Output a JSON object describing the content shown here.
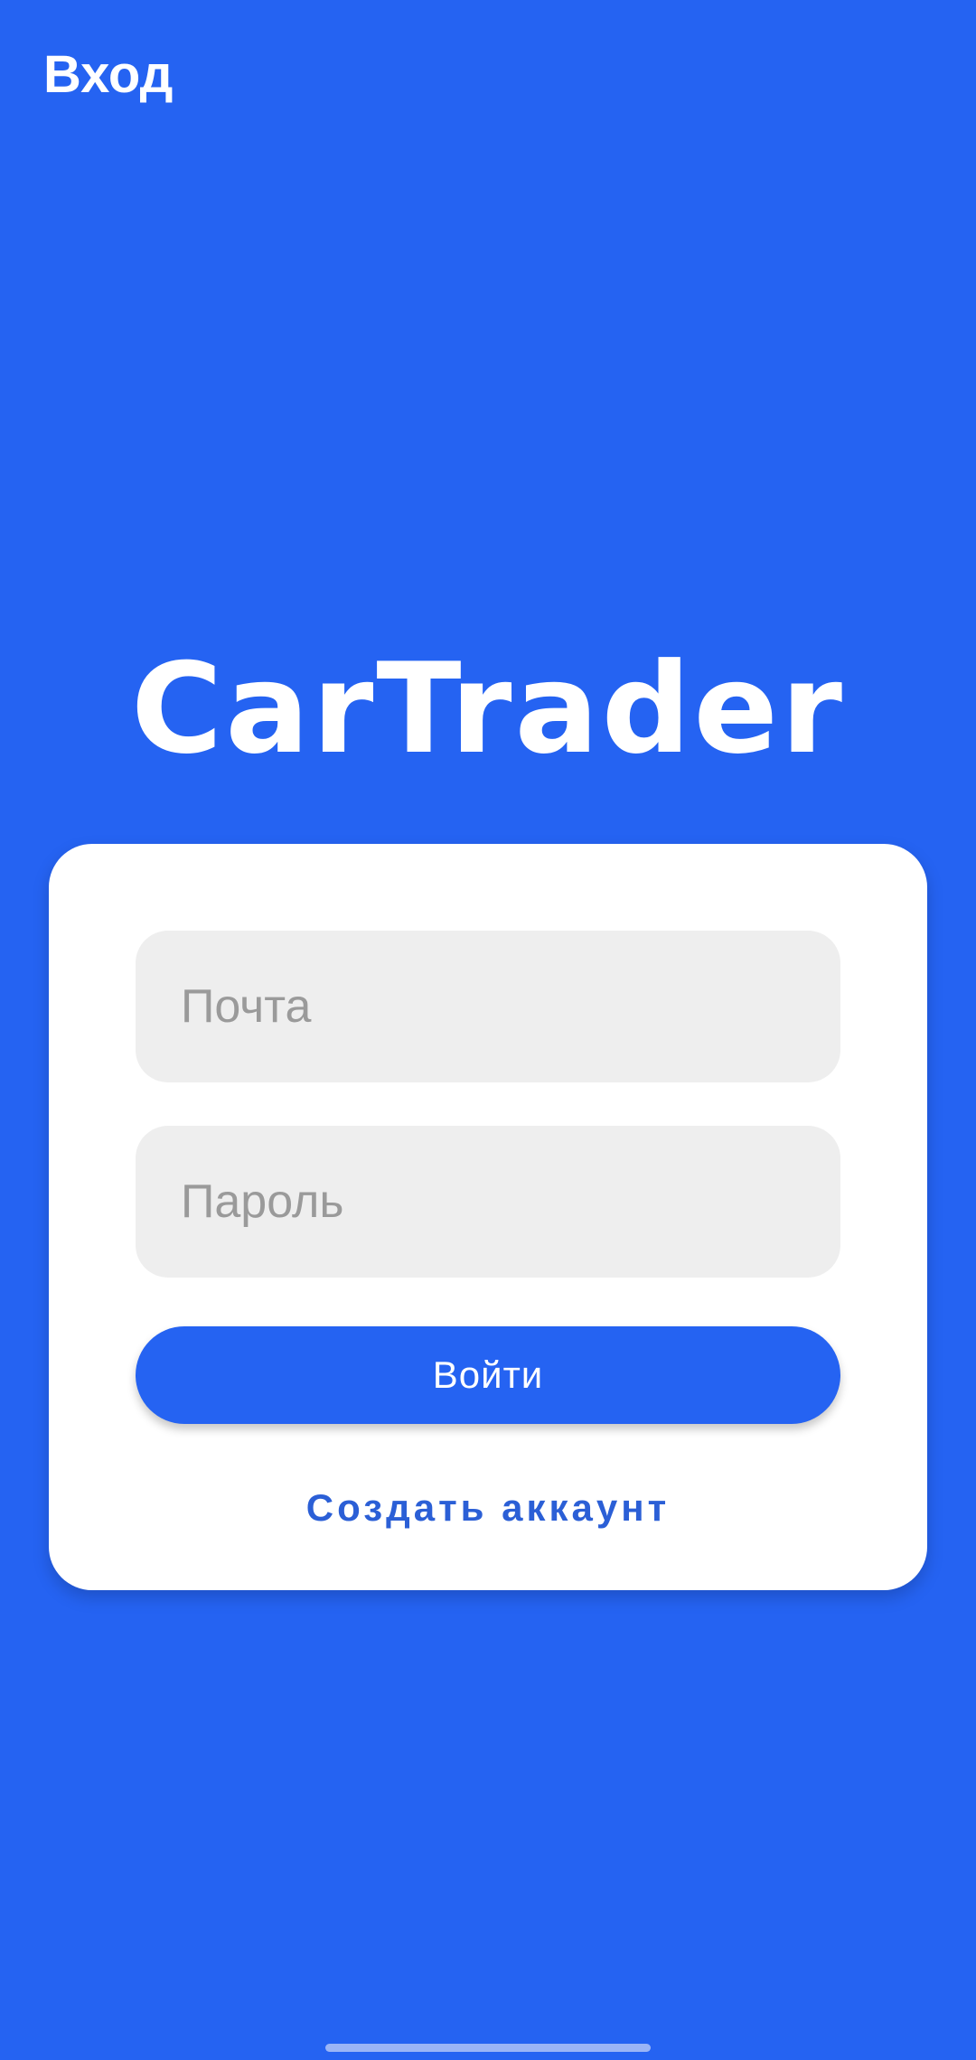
{
  "app_bar": {
    "title": "Вход"
  },
  "logo": {
    "text": "CarTrader"
  },
  "login_form": {
    "email_placeholder": "Почта",
    "password_placeholder": "Пароль",
    "login_button_label": "Войти",
    "create_account_label": "Создать аккаунт"
  },
  "colors": {
    "background": "#2563f2",
    "card": "#ffffff",
    "field_background": "#eeeeee",
    "button": "#2563f2",
    "link": "#2b5fd6"
  }
}
